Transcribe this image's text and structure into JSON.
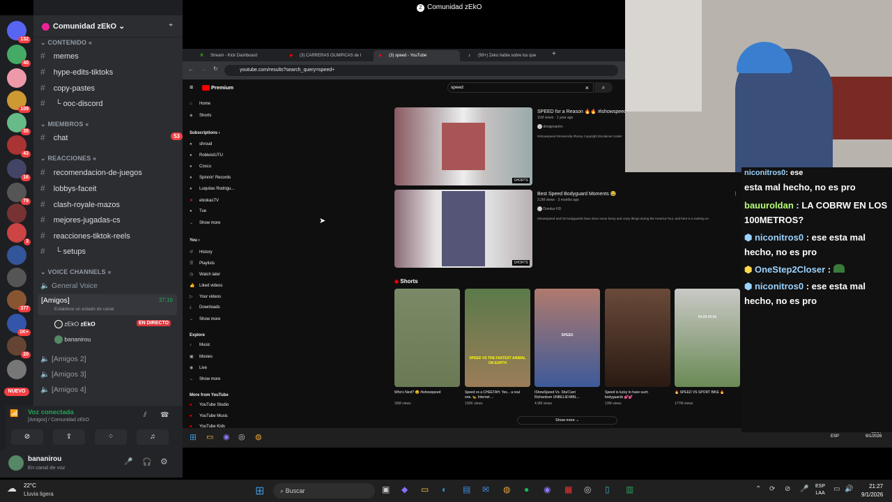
{
  "window": {
    "title": "Comunidad zEkO"
  },
  "rail": {
    "badges": [
      "132",
      "40",
      "109",
      "35",
      "43",
      "16",
      "79",
      "3",
      "377",
      "1K+",
      "20"
    ],
    "nuevo": "NUEVO"
  },
  "server": {
    "name": "Comunidad zEkO",
    "categories": {
      "contenido": "CONTENIDO",
      "miembros": "MIEMBROS",
      "reacciones": "REACCIONES",
      "voice": "VOICE CHANNELS"
    },
    "text_channels": [
      {
        "label": "memes"
      },
      {
        "label": "hype-edits-tiktoks"
      },
      {
        "label": "copy-pastes"
      },
      {
        "label": "ooc-discord"
      },
      {
        "label": "chat",
        "badge": "53"
      },
      {
        "label": "recomendacion-de-juegos"
      },
      {
        "label": "lobbys-faceit"
      },
      {
        "label": "clash-royale-mazos"
      },
      {
        "label": "mejores-jugadas-cs"
      },
      {
        "label": "reacciones-tiktok-reels"
      },
      {
        "label": "setups"
      }
    ],
    "voice_channels": {
      "general": "General Voice",
      "amigos": "[Amigos]",
      "amigos_time": "37:16",
      "amigos_status": "Establece un estado de canal",
      "members": [
        {
          "name": "zEkO",
          "tag": "zEkO",
          "live": "EN DIRECTO"
        },
        {
          "name": "bananirou"
        }
      ],
      "amigos2": "[Amigos 2]",
      "amigos3": "[Amigos 3]",
      "amigos4": "[Amigos 4]"
    },
    "voice_connected": {
      "title": "Voz conectada",
      "subtitle": "[Amigos] / Comunidad zEkO"
    },
    "user": {
      "name": "bananirou",
      "status": "En canal de voz"
    }
  },
  "browser": {
    "tabs": [
      {
        "label": "Stream - Kick Dashboard"
      },
      {
        "label": "(3) CARRERAS OLIMPICAS de l"
      },
      {
        "label": "(3) speed - YouTube"
      },
      {
        "label": "(99+) Zeko habla sobre los que"
      }
    ],
    "url": "youtube.com/results?search_query=speed+"
  },
  "youtube": {
    "logo": "Premium",
    "search": "speed",
    "sidebar_main": [
      "Home",
      "Shorts"
    ],
    "subscriptions_title": "Subscriptions",
    "subscriptions": [
      "shroud",
      "RobleisIUTU",
      "Coscu",
      "Spinnin' Records",
      "Luquitas Rodrigu...",
      "elxokasTV",
      "Tue"
    ],
    "show_more": "Show more",
    "you_title": "You",
    "you_items": [
      "History",
      "Playlists",
      "Watch later",
      "Liked videos",
      "Your videos",
      "Downloads"
    ],
    "explore_title": "Explore",
    "explore_items": [
      "Music",
      "Movies",
      "Live"
    ],
    "more_title": "More from YouTube",
    "more_items": [
      "YouTube Studio",
      "YouTube Music",
      "YouTube Kids"
    ],
    "results": [
      {
        "title": "SPEED for a Reason 🔥🔥 #ishowspeed",
        "meta": "11M views · 1 year ago",
        "channel": "designsantrv",
        "desc": "#ishowspeed #streamclip #funny Copyright Disclaimer Under",
        "tag": "SHORTS"
      },
      {
        "title": "Best Speed Bodyguard Moments 😂",
        "meta": "3.2M views · 3 months ago",
        "channel": "Dondus HD",
        "desc": "iShowSpeed and his bodyguards have done some funny and crazy things during the America Tour, and here is a ranking on",
        "tag": "SHORTS"
      }
    ],
    "shorts_title": "Shorts",
    "shorts": [
      {
        "title": "Who's Next? 😮 #ishowspeed",
        "views": "30M views"
      },
      {
        "title": "Speed vs a CHEETAH. Yes... a real one. 🐆 Internet ...",
        "views": "130K views"
      },
      {
        "title": "IShowSpeed Vs. Sha'Carri Richardson UNBELIEVABL...",
        "views": "4.9M views"
      },
      {
        "title": "Speed is lucky to have such bodyguards 💕💕",
        "views": "13M views"
      },
      {
        "title": "🔥 SPEED VS SPORT BIKE 🔥",
        "views": "177M views"
      }
    ],
    "short_captions": [
      "",
      "SPEED VS THE FASTEST ANIMAL ON EARTH",
      "SPEED",
      "",
      "04.05 00.00"
    ],
    "show_more_btn": "Show more"
  },
  "taskbar_inner": {
    "lang": "ESP",
    "time": "21:27",
    "date": "9/1/2026"
  },
  "taskbar": {
    "weather_temp": "22°C",
    "weather_desc": "Lluvia ligera",
    "search": "Buscar",
    "lang": "ESP",
    "lang2": "LAA",
    "time": "21:27",
    "date": "9/1/2026"
  },
  "chat": {
    "messages": [
      {
        "nick": "",
        "text": "esta mal hecho, no es pro"
      },
      {
        "nick": "bauuroldan",
        "text": ": LA COBRW EN LOS 100METROS?"
      },
      {
        "nick": "niconitros0",
        "text": ": ese esta mal hecho, no es pro"
      },
      {
        "nick": "OneStep2Closer",
        "text": ":"
      },
      {
        "nick": "niconitros0",
        "text": ": ese esta mal hecho, no es pro"
      }
    ],
    "top_nick": "niconitros0",
    "top_text": ": ese"
  },
  "colors": {
    "discord_bg": "#2b2d31",
    "live_red": "#da373c",
    "youtube_red": "#ff0000",
    "voice_green": "#23a55a"
  }
}
